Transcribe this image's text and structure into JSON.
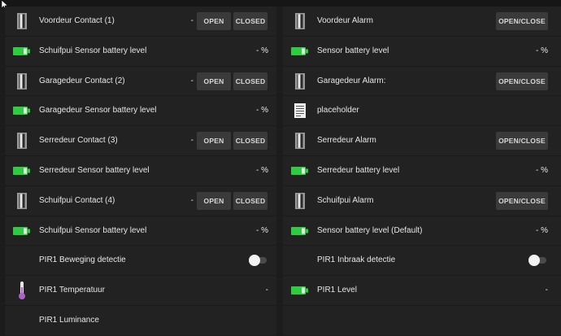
{
  "left_panel": {
    "rows": [
      {
        "label": "Voordeur Contact (1)",
        "icon": "door-contact-icon",
        "value": "-",
        "open_label": "OPEN",
        "closed_label": "CLOSED"
      },
      {
        "label": "Schuifpui Sensor battery level",
        "icon": "battery-icon",
        "value": "- %"
      },
      {
        "label": "Garagedeur Contact (2)",
        "icon": "door-contact-icon",
        "value": "-",
        "open_label": "OPEN",
        "closed_label": "CLOSED"
      },
      {
        "label": "Garagedeur Sensor battery level",
        "icon": "battery-icon",
        "value": "- %"
      },
      {
        "label": "Serredeur Contact (3)",
        "icon": "door-contact-icon",
        "value": "-",
        "open_label": "OPEN",
        "closed_label": "CLOSED"
      },
      {
        "label": "Serredeur Sensor battery level",
        "icon": "battery-icon",
        "value": "- %"
      },
      {
        "label": "Schuifpui Contact (4)",
        "icon": "door-contact-icon",
        "value": "-",
        "open_label": "OPEN",
        "closed_label": "CLOSED"
      },
      {
        "label": "Schuifpui Sensor battery level",
        "icon": "battery-icon",
        "value": "- %"
      },
      {
        "label": "PIR1 Beweging detectie",
        "icon": "motion-icon",
        "toggle": "off"
      },
      {
        "label": "PIR1 Temperatuur",
        "icon": "thermometer-icon",
        "value": "-"
      },
      {
        "label": "PIR1 Luminance",
        "icon": "light-icon"
      }
    ]
  },
  "right_panel": {
    "rows": [
      {
        "label": "Voordeur Alarm",
        "icon": "door-contact-icon",
        "button_label": "OPEN/CLOSE"
      },
      {
        "label": "Sensor battery level",
        "icon": "battery-icon",
        "value": "- %"
      },
      {
        "label": "Garagedeur Alarm:",
        "icon": "door-contact-icon",
        "button_label": "OPEN/CLOSE"
      },
      {
        "label": "placeholder",
        "icon": "document-icon"
      },
      {
        "label": "Serredeur Alarm",
        "icon": "door-contact-icon",
        "button_label": "OPEN/CLOSE"
      },
      {
        "label": "Serredeur battery level",
        "icon": "battery-icon",
        "value": "- %"
      },
      {
        "label": "Schuifpui Alarm",
        "icon": "door-contact-icon",
        "button_label": "OPEN/CLOSE"
      },
      {
        "label": "Sensor battery level (Default)",
        "icon": "battery-icon",
        "value": "- %"
      },
      {
        "label": "PIR1 Inbraak detectie",
        "icon": "motion-icon",
        "toggle": "off"
      },
      {
        "label": "PIR1 Level",
        "icon": "battery-icon",
        "value": "-"
      }
    ]
  },
  "colors": {
    "battery_green": "#2ecc40",
    "button_bg": "#3a3a3a",
    "panel_bg": "#222222",
    "page_bg": "#1c1c1c",
    "thermometer": "#b060c8"
  }
}
